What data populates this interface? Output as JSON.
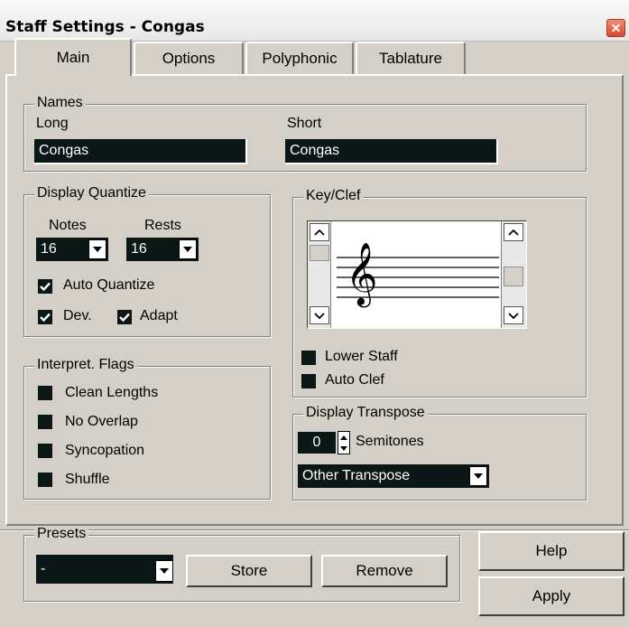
{
  "window": {
    "title": "Staff Settings - Congas"
  },
  "tabs": [
    {
      "label": "Main"
    },
    {
      "label": "Options"
    },
    {
      "label": "Polyphonic"
    },
    {
      "label": "Tablature"
    }
  ],
  "names": {
    "legend": "Names",
    "long_label": "Long",
    "long_value": "Congas",
    "short_label": "Short",
    "short_value": "Congas"
  },
  "display_quantize": {
    "legend": "Display Quantize",
    "notes_label": "Notes",
    "notes_value": "16",
    "rests_label": "Rests",
    "rests_value": "16",
    "auto_quantize_label": "Auto Quantize",
    "dev_label": "Dev.",
    "adapt_label": "Adapt"
  },
  "interpret_flags": {
    "legend": "Interpret. Flags",
    "clean_lengths_label": "Clean Lengths",
    "no_overlap_label": "No Overlap",
    "syncopation_label": "Syncopation",
    "shuffle_label": "Shuffle"
  },
  "key_clef": {
    "legend": "Key/Clef",
    "clef_glyph": "𝄞",
    "lower_staff_label": "Lower Staff",
    "auto_clef_label": "Auto Clef"
  },
  "display_transpose": {
    "legend": "Display Transpose",
    "semitones_value": "0",
    "semitones_label": "Semitones",
    "transpose_value": "Other Transpose"
  },
  "presets": {
    "legend": "Presets",
    "value": "-",
    "store_label": "Store",
    "remove_label": "Remove"
  },
  "buttons": {
    "help_label": "Help",
    "apply_label": "Apply"
  },
  "colors": {
    "field_bg": "#0b1616",
    "dialog_bg": "#d4d0c8",
    "close_red": "#d84a2e"
  }
}
